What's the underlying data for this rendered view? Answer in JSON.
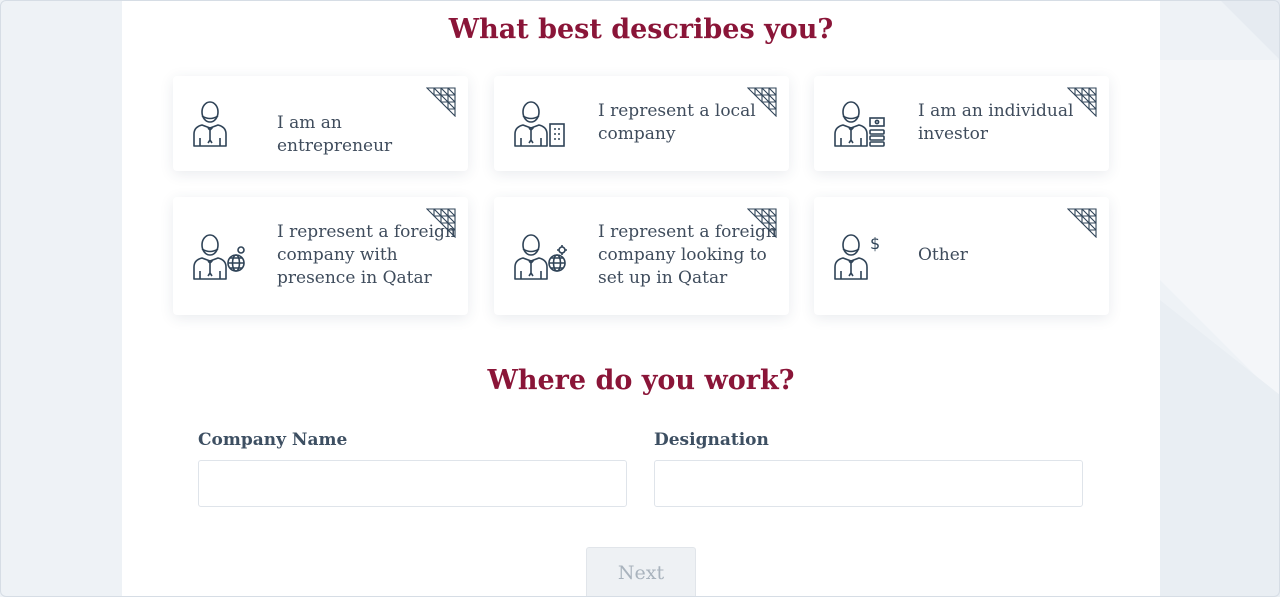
{
  "section_profile": {
    "heading": "What best describes you?",
    "options": [
      {
        "label": "I am an entrepreneur",
        "icon": "entrepreneur-icon"
      },
      {
        "label": "I represent a local company",
        "icon": "local-company-icon"
      },
      {
        "label": "I am an individual investor",
        "icon": "individual-investor-icon"
      },
      {
        "label": "I represent a foreign company with presence in Qatar",
        "icon": "foreign-company-presence-icon"
      },
      {
        "label": "I represent a foreign company looking to set up in Qatar",
        "icon": "foreign-company-setup-icon"
      },
      {
        "label": "Other",
        "icon": "other-icon"
      }
    ],
    "corner_icon": "triangle-grid-icon"
  },
  "section_work": {
    "heading": "Where do you work?",
    "company_name": {
      "label": "Company Name",
      "value": "",
      "placeholder": ""
    },
    "designation": {
      "label": "Designation",
      "value": "",
      "placeholder": ""
    }
  },
  "actions": {
    "next_label": "Next",
    "next_disabled": true
  },
  "colors": {
    "accent": "#8a1538",
    "icon_stroke": "#2f4357",
    "text": "#3f4c5c",
    "panel": "#ffffff",
    "page_bg": "#eef2f6"
  }
}
